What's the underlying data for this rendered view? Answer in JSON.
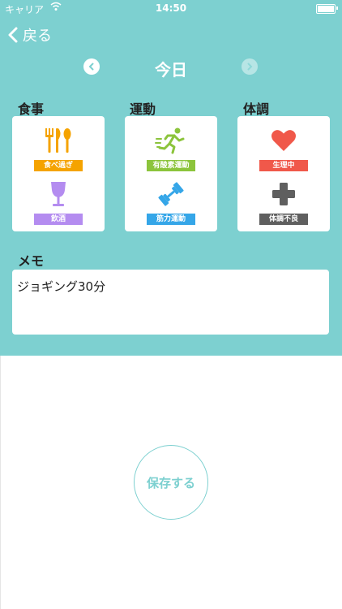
{
  "status_bar": {
    "carrier": "キャリア",
    "time": "14:50"
  },
  "nav": {
    "back_label": "戻る"
  },
  "date": {
    "title": "今日"
  },
  "sections": {
    "meal": {
      "label": "食事",
      "items": [
        {
          "label": "食べ過ぎ",
          "color": "#f5a300",
          "icon": "cutlery-icon"
        },
        {
          "label": "飲酒",
          "color": "#b48cf0",
          "icon": "wine-glass-icon"
        }
      ]
    },
    "exercise": {
      "label": "運動",
      "items": [
        {
          "label": "有酸素運動",
          "color": "#8cc43c",
          "icon": "runner-icon"
        },
        {
          "label": "筋力運動",
          "color": "#35a6e8",
          "icon": "dumbbell-icon"
        }
      ]
    },
    "condition": {
      "label": "体調",
      "items": [
        {
          "label": "生理中",
          "color": "#f0584a",
          "icon": "heart-icon"
        },
        {
          "label": "体調不良",
          "color": "#5f5f5f",
          "icon": "medical-cross-icon"
        }
      ]
    }
  },
  "memo": {
    "label": "メモ",
    "text": "ジョギング30分"
  },
  "save_button": {
    "label": "保存する"
  },
  "colors": {
    "teal": "#7dd0d0"
  }
}
